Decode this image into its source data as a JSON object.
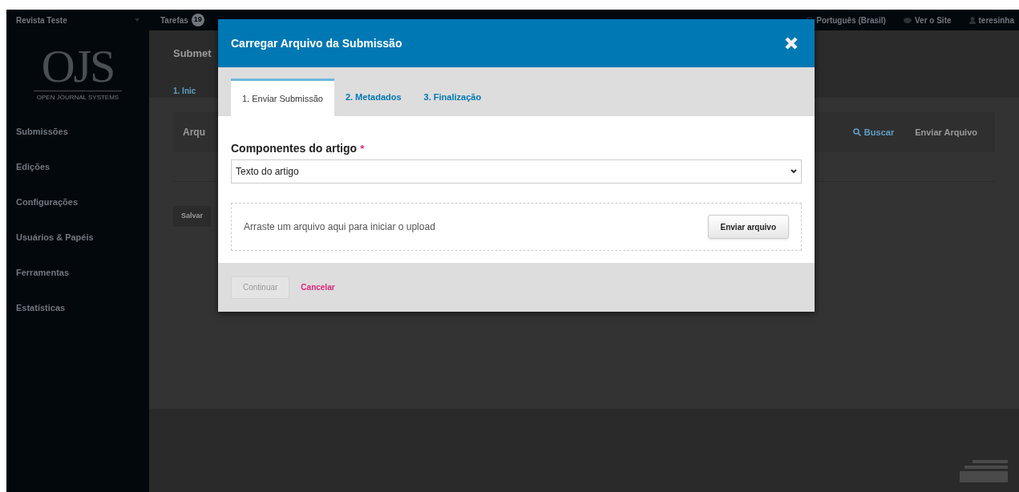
{
  "top_bar": {
    "journal": "Revista Teste",
    "tasks_label": "Tarefas",
    "tasks_count": "19",
    "language": "Português (Brasil)",
    "view_site": "Ver o Site",
    "user": "teresinha"
  },
  "logo": {
    "letters": "OJS",
    "tagline": "OPEN JOURNAL SYSTEMS"
  },
  "sidebar": {
    "items": [
      {
        "label": "Submissões"
      },
      {
        "label": "Edições"
      },
      {
        "label": "Configurações"
      },
      {
        "label": "Usuários & Papéis"
      },
      {
        "label": "Ferramentas"
      },
      {
        "label": "Estatísticas"
      }
    ]
  },
  "background_page": {
    "title": "Submet",
    "step": "1. Inic",
    "panel_title": "Arqu",
    "search": "Buscar",
    "upload": "Enviar Arquivo",
    "save": "Salvar"
  },
  "modal": {
    "title": "Carregar Arquivo da Submissão",
    "tabs": [
      {
        "label": "1. Enviar Submissão",
        "selected": true
      },
      {
        "label": "2. Metadados",
        "selected": false
      },
      {
        "label": "3. Finalização",
        "selected": false
      }
    ],
    "field_label": "Componentes do artigo",
    "required_mark": "*",
    "select_value": "Texto do artigo",
    "dropzone_text": "Arraste um arquivo aqui para iniciar o upload",
    "upload_button": "Enviar arquivo",
    "continue_button": {
      "label": "Continuar",
      "disabled": true
    },
    "cancel_link": "Cancelar"
  }
}
